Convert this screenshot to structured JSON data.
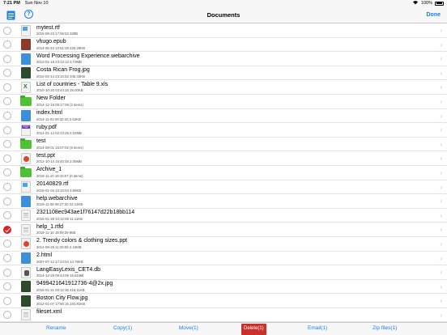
{
  "status": {
    "time": "7:21 PM",
    "date": "Sun Nov 10",
    "battery": "100%"
  },
  "nav": {
    "title": "Documents",
    "done_label": "Done",
    "help_glyph": "?"
  },
  "chevron": "›",
  "files": [
    {
      "name": "mytest.rtf",
      "meta": "2015-08-23 17:55:52  328B",
      "icon": "rtf",
      "selected": false
    },
    {
      "name": "vhugo.epub",
      "meta": "2014-06-10 10:51:28  226.29KB",
      "icon": "epub",
      "selected": false
    },
    {
      "name": "Word Processing Experience.webarchive",
      "meta": "2013-01-19 23:13:12  3.73MB",
      "icon": "web",
      "selected": false
    },
    {
      "name": "Costa Rican Frog.jpg",
      "meta": "2012-02-14 23:10:52  346.33KB",
      "icon": "img",
      "selected": false
    },
    {
      "name": "List of countries - Table 9.xls",
      "meta": "2010-10-20 03:44:16  26.00KB",
      "icon": "xls",
      "selected": false
    },
    {
      "name": "New Folder",
      "meta": "2014-12-15 09:17:08  (2 items)",
      "icon": "folder",
      "selected": false
    },
    {
      "name": "index.html",
      "meta": "2014-11-03 09:32:42  2.63KB",
      "icon": "web",
      "selected": false
    },
    {
      "name": "ruby.pdf",
      "meta": "2014-01-14 02:13:26  2.02MB",
      "icon": "pdf",
      "selected": false
    },
    {
      "name": "test",
      "meta": "2014-08-01 15:07:02  (5 items)",
      "icon": "folder",
      "selected": false
    },
    {
      "name": "test.ppt",
      "meta": "2012-10-14 16:40:48  2.05MB",
      "icon": "ppt",
      "selected": false
    },
    {
      "name": "Archive_1",
      "meta": "2019-11-10 18:15:07  (0 items)",
      "icon": "folder",
      "selected": false
    },
    {
      "name": "20140829.rtf",
      "meta": "2015-01-04 10:10:04  3.89KB",
      "icon": "rtf",
      "selected": false
    },
    {
      "name": "help.webarchive",
      "meta": "2019-11-08 08:27:30  22.13KB",
      "icon": "web",
      "selected": false
    },
    {
      "name": "2321108ec943ae1f76147d22b18bb114",
      "meta": "2015-01-28 10:12:08  11.11KB",
      "icon": "doc",
      "selected": false
    },
    {
      "name": "help_1.rtfd",
      "meta": "2019-11-10 19:09:39  96B",
      "icon": "doc",
      "selected": true
    },
    {
      "name": "2. Trendy colors & clothing sizes.ppt",
      "meta": "2014-09-25 11:25:06  2.15MB",
      "icon": "ppt",
      "selected": false
    },
    {
      "name": "2.html",
      "meta": "2007-07-12 17:24:04  14.78KB",
      "icon": "web",
      "selected": false
    },
    {
      "name": "LangEasyLexis_CET4.db",
      "meta": "2014-12-29 09:44:09  16.61MB",
      "icon": "db",
      "selected": false
    },
    {
      "name": "9499421641912736-4@2x.jpg",
      "meta": "2015-01-21 00:12:36  418.11KB",
      "icon": "img",
      "selected": false
    },
    {
      "name": "Boston City Flow.jpg",
      "meta": "2012-01-07 17:50:16  331.81KB",
      "icon": "img",
      "selected": false
    },
    {
      "name": "fileset.xml",
      "meta": "",
      "icon": "doc",
      "selected": false
    }
  ],
  "toolbar": {
    "rename": "Rename",
    "copy": "Copy(1)",
    "move": "Move(1)",
    "delete": "Delete(1)",
    "email": "Email(1)",
    "zip": "Zip files(1)"
  },
  "colors": {
    "accent": "#1a7cf5",
    "delete_bg": "#c9302c",
    "selected_check": "#e0201f",
    "folder": "#4cc234"
  }
}
